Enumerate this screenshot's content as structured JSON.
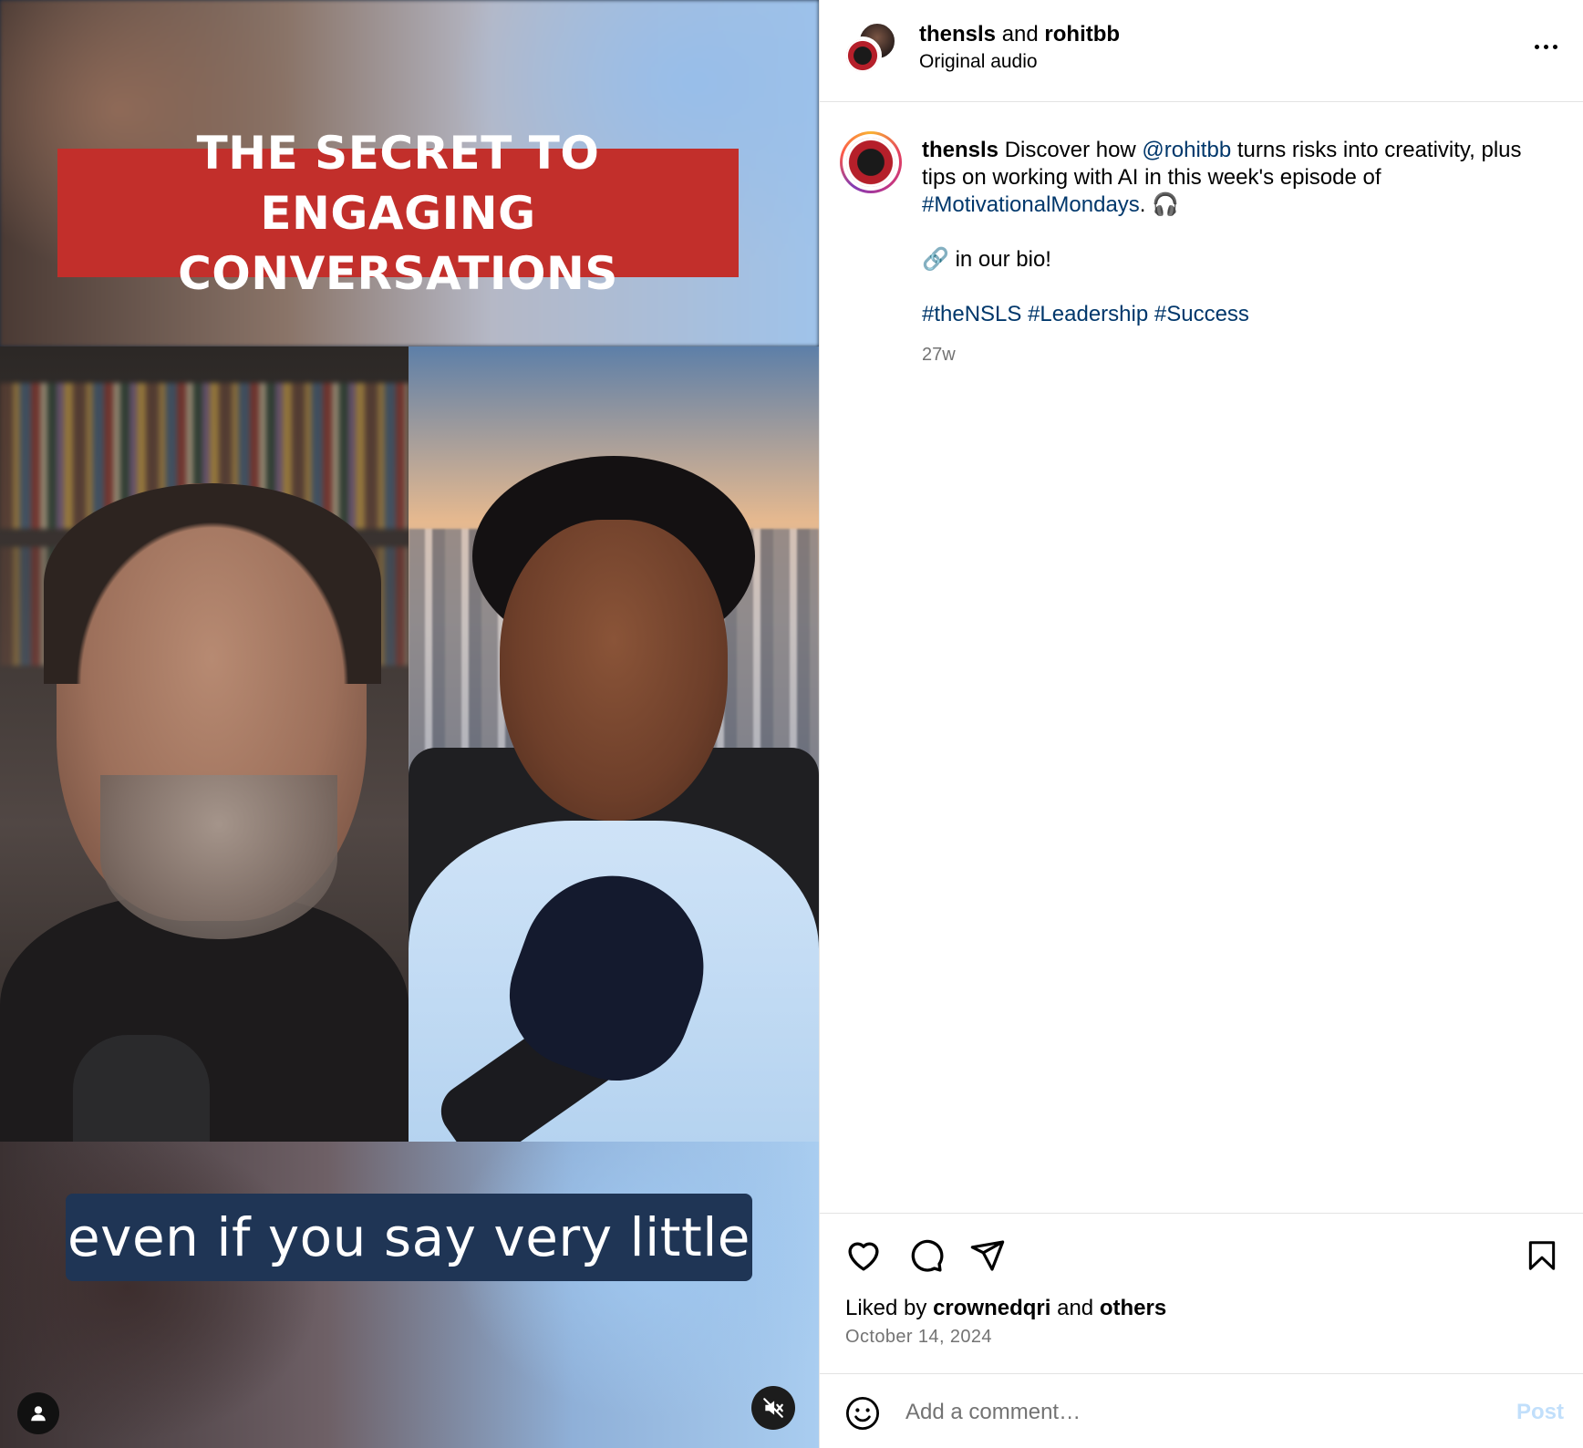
{
  "video": {
    "title_overlay": "THE SECRET TO ENGAGING\nCONVERSATIONS",
    "subtitle": "even if you say very little"
  },
  "header": {
    "user1": "thensls",
    "connector": "and",
    "user2": "rohitbb",
    "audio": "Original audio"
  },
  "caption": {
    "username": "thensls",
    "text_before_mention": "Discover how",
    "mention": "@rohitbb",
    "text_after_mention": "turns risks into creativity, plus tips on working with AI in this week's episode of",
    "hashtag_main": "#MotivationalMondays",
    "text_end": ".",
    "emoji_headphones": "🎧",
    "emoji_link": "🔗",
    "bio_text": "in our bio!",
    "hashtags": [
      "#theNSLS",
      "#Leadership",
      "#Success"
    ],
    "time_ago": "27w"
  },
  "engagement": {
    "liked_prefix": "Liked by",
    "liked_user": "crownedqri",
    "liked_connector": "and",
    "liked_others": "others",
    "date": "October 14, 2024"
  },
  "comment": {
    "placeholder": "Add a comment…",
    "post_label": "Post"
  },
  "icons": {
    "more": "more-options-icon",
    "like": "heart-icon",
    "comment": "comment-icon",
    "share": "share-icon",
    "save": "bookmark-icon",
    "emoji": "emoji-icon",
    "mute": "muted-speaker-icon",
    "tagged": "user-icon"
  },
  "colors": {
    "link": "#00376b",
    "title_bg": "#c22f2b",
    "caption_bg": "#1f3555",
    "post_disabled": "#c1dffb",
    "muted_text": "#737373"
  }
}
